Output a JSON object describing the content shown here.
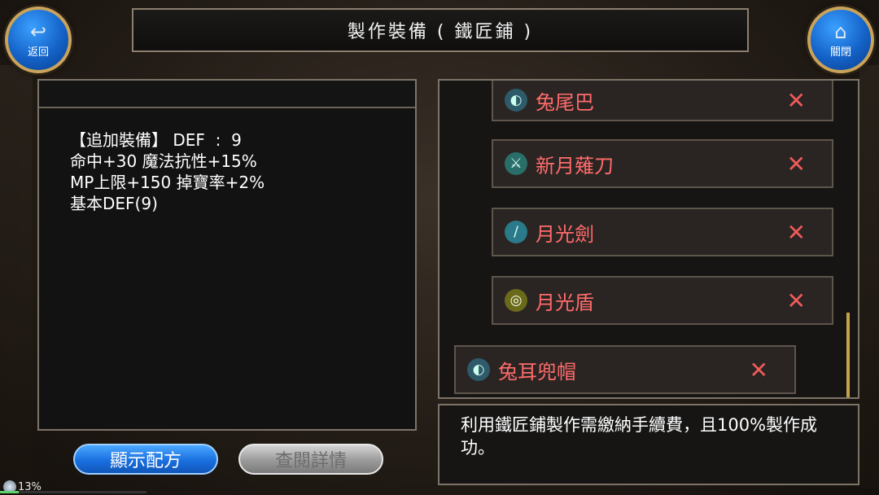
{
  "header": {
    "back_label": "返回",
    "close_label": "關閉",
    "title": "製作裝備 ( 鐵匠鋪 )"
  },
  "left_panel": {
    "stats": "【追加裝備】 DEF  :  9\n命中+30 魔法抗性+15%\nMP上限+150 掉寶率+2%\n基本DEF(9)"
  },
  "items": [
    {
      "name": "兔尾巴",
      "icon": "bunny-tail-icon"
    },
    {
      "name": "新月薙刀",
      "icon": "crescent-glaive-icon"
    },
    {
      "name": "月光劍",
      "icon": "moonlight-sword-icon"
    },
    {
      "name": "月光盾",
      "icon": "moonlight-shield-icon"
    },
    {
      "name": "兔耳兜帽",
      "icon": "bunny-hood-icon"
    }
  ],
  "info": {
    "text": "利用鐵匠鋪製作需繳納手續費，且100%製作成功。"
  },
  "buttons": {
    "recipe": "顯示配方",
    "detail": "查閱詳情"
  },
  "footer": {
    "percent_label": "13%",
    "progress": 0.13
  },
  "colors": {
    "accent_blue": "#1a6fe0",
    "item_text": "#ff6b6b",
    "frame_gold": "#c9a35a"
  }
}
